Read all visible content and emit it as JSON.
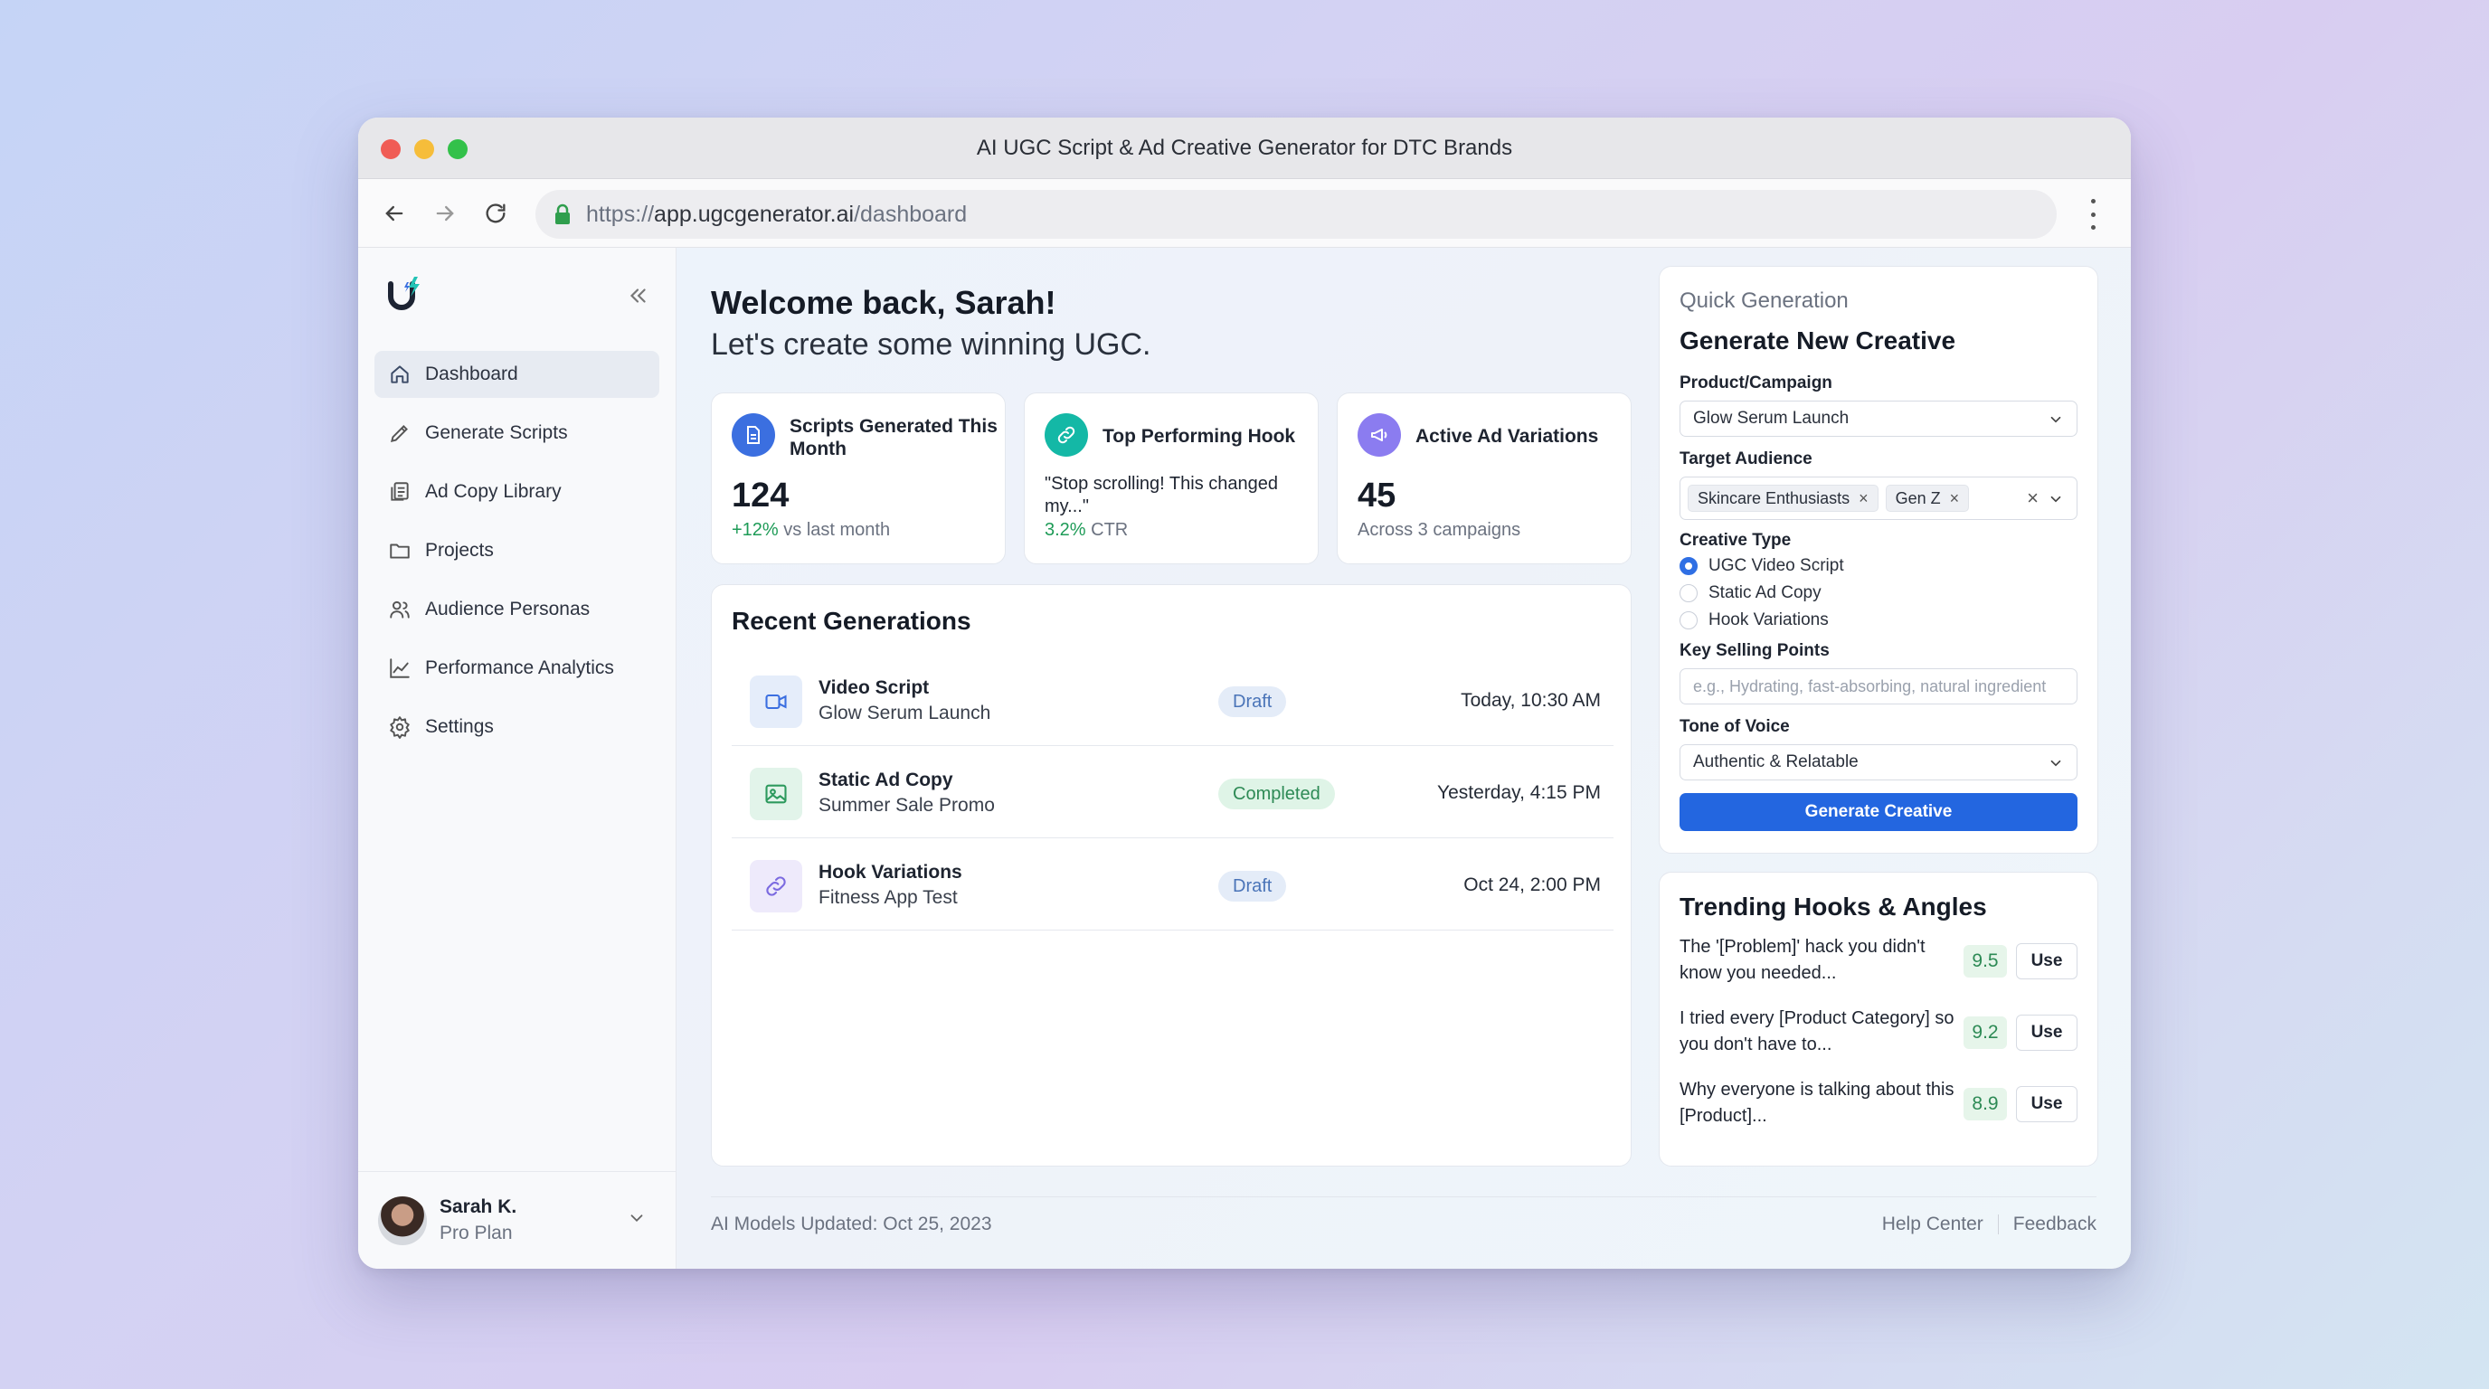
{
  "window": {
    "title": "AI UGC Script & Ad Creative Generator for DTC Brands"
  },
  "browser": {
    "url_scheme": "https://",
    "url_domain": "app.ugcgenerator.ai",
    "url_path": "/dashboard"
  },
  "sidebar": {
    "items": [
      {
        "label": "Dashboard",
        "icon": "home-icon",
        "active": true
      },
      {
        "label": "Generate Scripts",
        "icon": "pencil-icon"
      },
      {
        "label": "Ad Copy Library",
        "icon": "document-stack-icon"
      },
      {
        "label": "Projects",
        "icon": "folder-icon"
      },
      {
        "label": "Audience Personas",
        "icon": "users-icon"
      },
      {
        "label": "Performance Analytics",
        "icon": "line-chart-icon"
      },
      {
        "label": "Settings",
        "icon": "gear-icon"
      }
    ],
    "user": {
      "name": "Sarah K.",
      "plan": "Pro Plan"
    }
  },
  "main": {
    "greeting": "Welcome back, Sarah!",
    "subgreeting": "Let's create some winning UGC.",
    "stats": [
      {
        "title": "Scripts Generated This Month",
        "value": "124",
        "change": "+12%",
        "change_suffix": " vs last month",
        "icon": "document-icon",
        "color": "#3b6fe0"
      },
      {
        "title": "Top Performing Hook",
        "quote": "\"Stop scrolling! This changed my...\"",
        "ctr": "3.2%",
        "ctr_suffix": " CTR",
        "icon": "link-icon",
        "color": "#14b8a6"
      },
      {
        "title": "Active Ad Variations",
        "value": "45",
        "sub": "Across 3 campaigns",
        "icon": "megaphone-icon",
        "color": "#8b7cf0"
      }
    ],
    "recent": {
      "title": "Recent Generations",
      "rows": [
        {
          "title": "Video Script",
          "subtitle": "Glow Serum Launch",
          "status": "Draft",
          "time": "Today, 10:30 AM",
          "icon": "video-icon"
        },
        {
          "title": "Static Ad Copy",
          "subtitle": "Summer Sale Promo",
          "status": "Completed",
          "time": "Yesterday, 4:15 PM",
          "icon": "image-icon"
        },
        {
          "title": "Hook Variations",
          "subtitle": "Fitness App Test",
          "status": "Draft",
          "time": "Oct 24, 2:00 PM",
          "icon": "link-icon"
        }
      ]
    }
  },
  "quick": {
    "label": "Quick Generation",
    "title": "Generate New Creative",
    "product_label": "Product/Campaign",
    "product_value": "Glow Serum Launch",
    "audience_label": "Target Audience",
    "audience_chips": [
      "Skincare Enthusiasts",
      "Gen Z"
    ],
    "creative_label": "Creative Type",
    "creative_options": [
      "UGC Video Script",
      "Static Ad Copy",
      "Hook Variations"
    ],
    "creative_selected": "UGC Video Script",
    "selling_label": "Key Selling Points",
    "selling_placeholder": "e.g., Hydrating, fast-absorbing, natural ingredient",
    "tone_label": "Tone of Voice",
    "tone_value": "Authentic & Relatable",
    "button": "Generate Creative"
  },
  "hooks": {
    "title": "Trending Hooks & Angles",
    "items": [
      {
        "text": "The '[Problem]' hack you didn't know you needed...",
        "score": "9.5",
        "action": "Use"
      },
      {
        "text": "I tried every [Product Category] so you don't have to...",
        "score": "9.2",
        "action": "Use"
      },
      {
        "text": "Why everyone is talking about this [Product]...",
        "score": "8.9",
        "action": "Use"
      }
    ]
  },
  "footer": {
    "left": "AI Models Updated: Oct 25, 2023",
    "help": "Help Center",
    "feedback": "Feedback"
  }
}
